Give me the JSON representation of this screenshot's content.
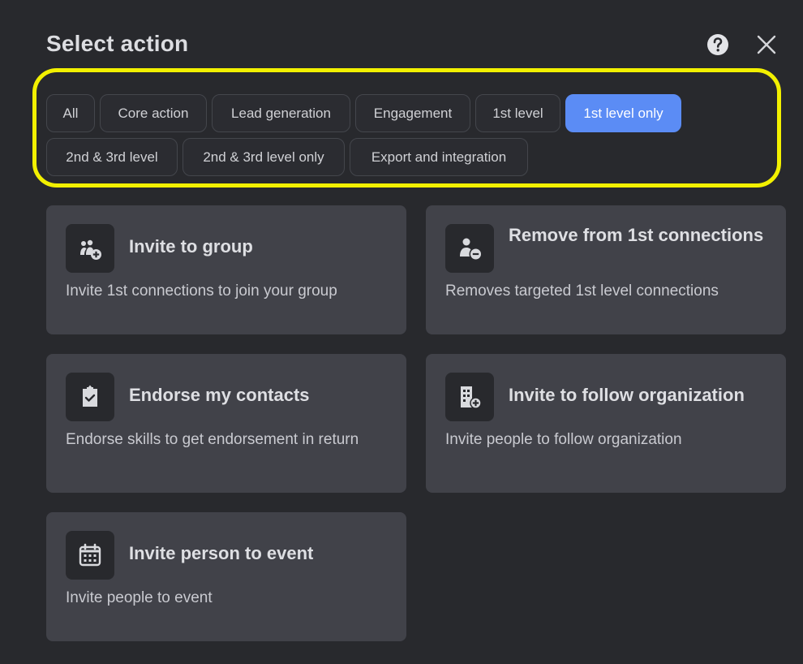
{
  "header": {
    "title": "Select action",
    "help_icon": "question-circle-icon",
    "close_icon": "close-icon"
  },
  "filters": {
    "chips": [
      {
        "label": "All",
        "active": false
      },
      {
        "label": "Core action",
        "active": false
      },
      {
        "label": "Lead generation",
        "active": false
      },
      {
        "label": "Engagement",
        "active": false
      },
      {
        "label": "1st level",
        "active": false
      },
      {
        "label": "1st level only",
        "active": true
      },
      {
        "label": "2nd & 3rd level",
        "active": false
      },
      {
        "label": "2nd & 3rd level only",
        "active": false
      },
      {
        "label": "Export and integration",
        "active": false
      }
    ],
    "highlight_color": "#f2f000",
    "active_color": "#5b8cf5"
  },
  "actions": [
    {
      "title": "Invite to group",
      "description": "Invite 1st connections to join your group",
      "icon": "group-add-icon"
    },
    {
      "title": "Remove from 1st connections",
      "description": "Removes targeted 1st level connections",
      "icon": "person-remove-icon"
    },
    {
      "title": "Endorse my contacts",
      "description": "Endorse skills to get endorsement in return",
      "icon": "clipboard-check-icon"
    },
    {
      "title": "Invite to follow organization",
      "description": "Invite people to follow organization",
      "icon": "building-add-icon"
    },
    {
      "title": "Invite person to event",
      "description": "Invite people to event",
      "icon": "calendar-icon"
    }
  ]
}
